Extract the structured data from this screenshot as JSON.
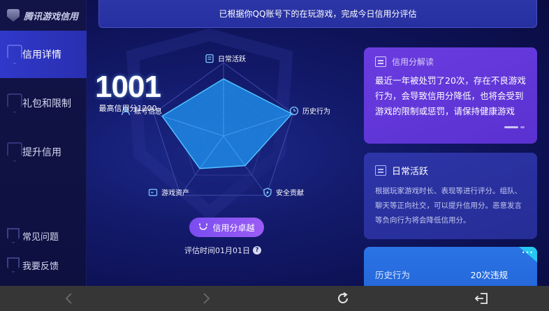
{
  "brand": {
    "name": "腾讯游戏信用"
  },
  "sidebar": {
    "items": [
      {
        "label": "信用详情",
        "active": true
      },
      {
        "label": "礼包和限制",
        "active": false
      },
      {
        "label": "提升信用",
        "active": false
      }
    ],
    "bottom_items": [
      {
        "label": "常见问题"
      },
      {
        "label": "我要反馈"
      }
    ]
  },
  "banner": {
    "text": "已根据你QQ账号下的在玩游戏，完成今日信用分评估"
  },
  "radar": {
    "axes": [
      {
        "label": "日常活跃",
        "icon": "daily-active-icon"
      },
      {
        "label": "历史行为",
        "icon": "history-clock-icon"
      },
      {
        "label": "安全贡献",
        "icon": "shield-icon"
      },
      {
        "label": "游戏资产",
        "icon": "wallet-icon"
      },
      {
        "label": "账号信息",
        "icon": "user-icon"
      }
    ],
    "values": [
      0.78,
      0.98,
      0.5,
      0.55,
      0.88
    ]
  },
  "score": {
    "value": "1001",
    "max_text": "最高信用分1200"
  },
  "level": {
    "label": "信用分卓越"
  },
  "eval_time": {
    "text": "评估时间01月01日"
  },
  "cards": {
    "interpret": {
      "title": "信用分解读",
      "body": "最近一年被处罚了20次，存在不良游戏行为，会导致信用分降低，也将会受到游戏的限制或惩罚，请保持健康游戏"
    },
    "daily": {
      "title": "日常活跃",
      "body": "根据玩家游戏时长、表现等进行评分。组队、聊天等正向社交，可以提升信用分。恶意发言等负向行为将会降低信用分。"
    },
    "history": {
      "label": "历史行为",
      "value": "20次违规"
    }
  },
  "colors": {
    "accent": "#2f38c9",
    "purple": "#6a3ce0",
    "radar_fill": "#1e88e5"
  }
}
